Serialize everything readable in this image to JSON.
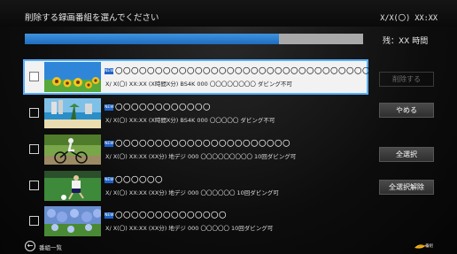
{
  "header": {
    "title": "削除する録画番組を選んでください",
    "clock": "X/X(〇) XX:XX"
  },
  "progress": {
    "used_fraction": 0.75
  },
  "remaining": "残：XX 時間",
  "rows": [
    {
      "name": "〇〇〇〇〇〇〇〇〇〇〇〇〇〇〇〇〇〇〇〇〇〇〇〇〇〇〇〇〇〇〇〇",
      "meta": "X/ X(〇) XX:XX (X時間X分) BS4K 000 〇〇〇〇〇〇〇〇  ダビング不可",
      "badge": "NEW",
      "selected": true
    },
    {
      "name": "〇〇〇〇〇〇〇〇〇〇〇〇",
      "meta": "X/ X(〇) XX:XX (X時間X分) BS4K 000 〇〇〇〇〇  ダビング不可",
      "badge": "NEW",
      "selected": false
    },
    {
      "name": "〇〇〇〇〇〇〇〇〇〇〇〇〇〇〇〇〇〇〇〇〇〇",
      "meta": "X/ X(〇) XX:XX (XX分) 地デジ 000 〇〇〇〇〇〇〇〇〇  10回ダビング可",
      "badge": "NEW",
      "selected": false
    },
    {
      "name": "〇〇〇〇〇〇",
      "meta": "X/ X(〇) XX:XX (XX分) 地デジ 000 〇〇〇〇〇〇  10回ダビング可",
      "badge": "NEW",
      "selected": false
    },
    {
      "name": "〇〇〇〇〇〇〇〇〇〇〇〇〇〇",
      "meta": "X/ X(〇) XX:XX (XX分) 地デジ 000 〇〇〇〇〇  10回ダビング可",
      "badge": "NEW",
      "selected": false
    }
  ],
  "buttons": {
    "delete": "削除する",
    "cancel": "やめる",
    "select_all": "全選択",
    "deselect_all": "全選択解除"
  },
  "footer": {
    "back_label": "番組一覧",
    "logo_text": "番組"
  }
}
